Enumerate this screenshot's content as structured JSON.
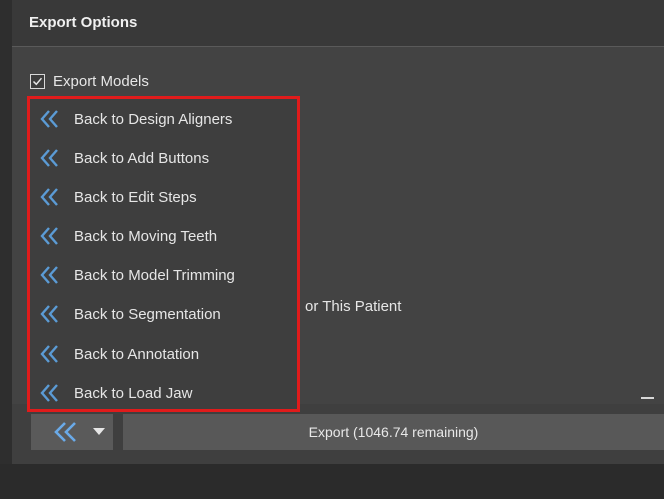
{
  "header": {
    "title": "Export Options"
  },
  "export_models": {
    "label": "Export Models",
    "checked": true
  },
  "background_text": "or This Patient",
  "back_menu": {
    "items": [
      {
        "label": "Back to Design Aligners",
        "icon": "double-chevron-left-icon"
      },
      {
        "label": "Back to Add Buttons",
        "icon": "double-chevron-left-icon"
      },
      {
        "label": "Back to Edit Steps",
        "icon": "double-chevron-left-icon"
      },
      {
        "label": "Back to Moving Teeth",
        "icon": "double-chevron-left-icon"
      },
      {
        "label": "Back to Model Trimming",
        "icon": "double-chevron-left-icon"
      },
      {
        "label": "Back to Segmentation",
        "icon": "double-chevron-left-icon"
      },
      {
        "label": "Back to Annotation",
        "icon": "double-chevron-left-icon"
      },
      {
        "label": "Back to Load Jaw",
        "icon": "double-chevron-left-icon"
      }
    ]
  },
  "footer": {
    "export_label": "Export (1046.74 remaining)"
  },
  "colors": {
    "accent": "#5b9bd5",
    "highlight_border": "#e01b1b",
    "panel": "#434343",
    "header": "#393939"
  }
}
